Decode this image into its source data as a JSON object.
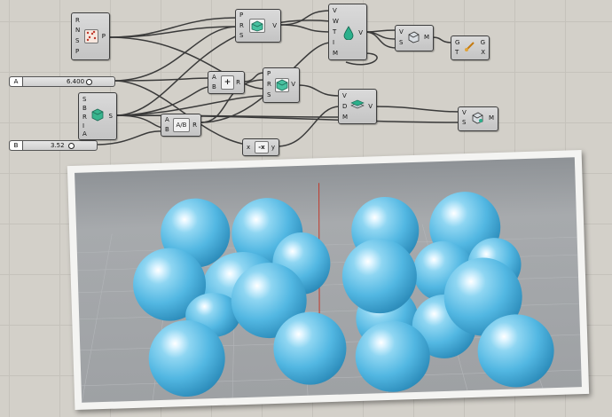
{
  "canvas": {
    "grid_color": "#c5c2bb",
    "background": "#d3d0c9",
    "wire_color": "#3a3a3a"
  },
  "sliders": [
    {
      "tag": "A",
      "value": "6.400"
    },
    {
      "tag": "B",
      "value": "3.52"
    }
  ],
  "components": {
    "pop": {
      "inputs": [
        "R",
        "N",
        "S",
        "P"
      ],
      "outputs": [
        "P"
      ],
      "icon": "populate-icon"
    },
    "box1": {
      "inputs": [
        "P",
        "R",
        "S"
      ],
      "outputs": [
        "V"
      ],
      "icon": "box-icon"
    },
    "metaball": {
      "inputs": [
        "V",
        "W",
        "T",
        "I",
        "M"
      ],
      "outputs": [
        "V"
      ],
      "icon": "drop-icon"
    },
    "mesh1": {
      "inputs": [
        "V",
        "S"
      ],
      "outputs": [
        "M"
      ],
      "icon": "mesh-icon"
    },
    "out1": {
      "inputs": [
        "G",
        "T"
      ],
      "outputs": [
        "G",
        "X"
      ],
      "icon": "transform-icon"
    },
    "add": {
      "inputs": [
        "A",
        "B"
      ],
      "outputs": [
        "R"
      ],
      "symbol": "+"
    },
    "box2": {
      "inputs": [
        "P",
        "R",
        "S"
      ],
      "outputs": [
        "V"
      ],
      "icon": "box-icon"
    },
    "series": {
      "inputs": [
        "S",
        "B",
        "R",
        "I",
        "A"
      ],
      "outputs": [
        "S"
      ],
      "icon": "cube-icon"
    },
    "divide": {
      "inputs": [
        "A",
        "B"
      ],
      "outputs": [
        "R"
      ],
      "symbol": "A/B"
    },
    "voxel": {
      "inputs": [
        "V",
        "D",
        "M"
      ],
      "outputs": [
        "V"
      ],
      "icon": "layer-icon"
    },
    "mesh2": {
      "inputs": [
        "V",
        "S"
      ],
      "outputs": [
        "M"
      ],
      "icon": "mesh-icon"
    },
    "neg": {
      "inputs": [
        "x"
      ],
      "outputs": [
        "y"
      ],
      "symbol": "-x"
    }
  },
  "viewport": {
    "sphere_color": "#52b7e2",
    "axis_color": "#c0392b"
  }
}
